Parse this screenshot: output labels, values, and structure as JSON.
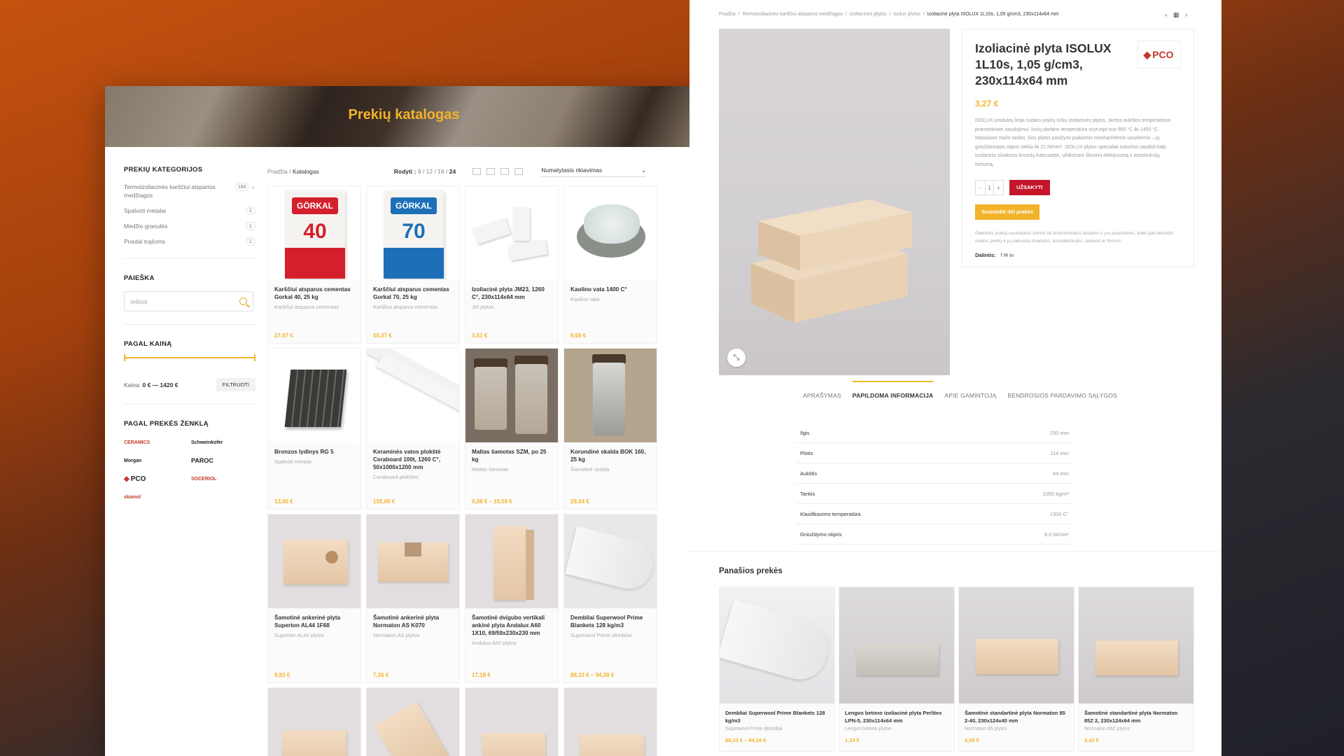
{
  "catalog": {
    "hero_title": "Prekių katalogas",
    "categories_heading": "PREKIŲ KATEGORIJOS",
    "categories": [
      {
        "label": "Termoizoliacinės karščiui atsparios medžiagos",
        "count": "184"
      },
      {
        "label": "Spalvoti metalai",
        "count": "2"
      },
      {
        "label": "Medžio granulės",
        "count": "1"
      },
      {
        "label": "Priedai trąšoms",
        "count": "1"
      }
    ],
    "search_heading": "PAIEŠKA",
    "search_placeholder": "Ieškoti",
    "price_heading": "PAGAL KAINĄ",
    "price_label": "Kaina:",
    "price_range": "0 € — 1420 €",
    "filter_button": "FILTRUOTI",
    "brand_heading": "PAGAL PREKĖS ŽENKLĄ",
    "brands": [
      "CERAMICS",
      "Schweinkofer",
      "Morgan",
      "PAROC",
      "PCO",
      "SOCERIOL",
      "skamol"
    ],
    "breadcrumb_home": "Pradžia",
    "breadcrumb_sep": "/",
    "breadcrumb_current": "Katalogas",
    "show_label": "Rodyti :",
    "show_opts": [
      "9",
      "12",
      "18",
      "24"
    ],
    "sort_label": "Numatytasis rikiavimas",
    "products": [
      {
        "name": "Karščiui atsparus cementas Gorkal 40, 25 kg",
        "cat": "Karščiui atsparus cementas",
        "price": "27,07 €"
      },
      {
        "name": "Karščiui atsparus cementas Gorkal 70, 25 kg",
        "cat": "Karščiui atsparus cementas",
        "price": "50,37 €"
      },
      {
        "name": "Izoliacinė plyta JM23, 1260 C°, 230x114x64 mm",
        "cat": "JM plytos",
        "price": "3,51 €"
      },
      {
        "name": "Kaolino vata 1400 C°",
        "cat": "Kaolino vata",
        "price": "9,68 €"
      },
      {
        "name": "Bronzos lydinys RG 5",
        "cat": "Spalvoti metalai",
        "price": "13,90 €"
      },
      {
        "name": "Keraminės vatos plokštė Ceraboard 100t, 1260 C°, 50x1000x1200 mm",
        "cat": "Ceraboard plokštės",
        "price": "155,00 €"
      },
      {
        "name": "Maltas šamotas SZM, po 25 kg",
        "cat": "Maltas šamotas",
        "price": "9,08 € – 10,59 €"
      },
      {
        "name": "Korundinė skalda BOK 160, 25 kg",
        "cat": "Šamotinė skalda",
        "price": "29,04 €"
      },
      {
        "name": "Šamotinė ankerinė plyta Superton AL44 1F68",
        "cat": "Superton AL44 plytos",
        "price": "8,83 €"
      },
      {
        "name": "Šamotinė ankerinė plyta Normaton AS K070",
        "cat": "Normaton AS plytos",
        "price": "7,26 €"
      },
      {
        "name": "Šamotinė dvigubo vertikali ankinė plyta Andalux A60 1X10, 69/59x230x230 mm",
        "cat": "Andalux A60 plytos",
        "price": "17,18 €"
      },
      {
        "name": "Dembliai Superwool Prime Blankets 128 kg/m3",
        "cat": "Superwool Prime dembliai",
        "price": "88,33 € – 94,39 €"
      }
    ],
    "gorkal": {
      "brand": "GÖRKAL",
      "n40": "40",
      "n70": "70"
    }
  },
  "product": {
    "breadcrumb": [
      "Pradžia",
      "Termoizoliacinės karščiui atsparios medžiagos",
      "Izoliacinės plytos",
      "Isolux plytos"
    ],
    "breadcrumb_current": "Izoliacinė plyta ISOLUX 1L10s, 1,05 g/cm3, 230x114x64 mm",
    "nav_icons": "‹ ▦ ›",
    "title": "Izoliacinė plyta ISOLUX 1L10s, 1,05 g/cm3, 230x114x64 mm",
    "brand_logo": "PCO",
    "price": "3,27 €",
    "description": "ISOLUX produktų linija sudaro įvairių rūšių izoliacinės plytos, skirtos aukštos temperatūros pramoniniam naudojimui, kurių darbinė temperatūra svyruoja nuo 900 °C iki 1400 °C. Nepaisant mažo tankio, šios plytos pasižymi puikiomis mechaninėmis savybėmis – jų gniuždomasis stipris siekia iki 21 N/mm². ISOLUX plytos specialiai sukurtos naudoti kaip izoliacinis sluoksnis krosnių futeruotėje, užtikrinant šiluminį efektyvumą ir konstrukcijų tvirtumą.",
    "qty_minus": "-",
    "qty": "1",
    "qty_plus": "+",
    "order_button": "UŽSAKYTI",
    "contact_button": "Susisiekti dėl prekės",
    "note": "Pateiktos prekių nuotraukos skirtos tik iliustraciniams tikslams ir yra pavyzdinės, todėl gali nesutikti realios prekių ir jų pakuočių išvaizdos, komplektacijos, spalvos ar formos.",
    "share_label": "Dalintis:",
    "share_icons": "f ✉ in",
    "zoom_icon": "⤡",
    "tabs": [
      "APRAŠYMAS",
      "PAPILDOMA INFORMACIJA",
      "APIE GAMINTOJĄ",
      "BENDROSIOS PARDAVIMO SĄLYGOS"
    ],
    "attributes": [
      {
        "k": "Ilgis",
        "v": "230 mm"
      },
      {
        "k": "Plotis",
        "v": "114 mm"
      },
      {
        "k": "Aukštis",
        "v": "64 mm"
      },
      {
        "k": "Tankis",
        "v": "1050 kg/m³"
      },
      {
        "k": "Klasifikavimo temperatūra",
        "v": "1300 C°"
      },
      {
        "k": "Gniuždymo stipris",
        "v": "8,0 N/mm²"
      }
    ],
    "related_heading": "Panašios prekės",
    "related": [
      {
        "name": "Dembliai Superwool Prime Blankets 128 kg/m3",
        "cat": "Superwool Prime dembliai",
        "price": "88,33 € – 94,39 €"
      },
      {
        "name": "Lengvo betono izoliacinė plyta Perlitex LPN-5, 230x114x64 mm",
        "cat": "Lengvo betono plytos",
        "price": "1,33 €"
      },
      {
        "name": "Šamotinė standartinė plyta Normaton 85 2-40, 230x124x40 mm",
        "cat": "Normaton 85 plytos",
        "price": "2,00 €"
      },
      {
        "name": "Šamotinė standartinė plyta Normaton 85Z 2, 230x124x64 mm",
        "cat": "Normaton 85Z plytos",
        "price": "2,42 €"
      }
    ]
  }
}
